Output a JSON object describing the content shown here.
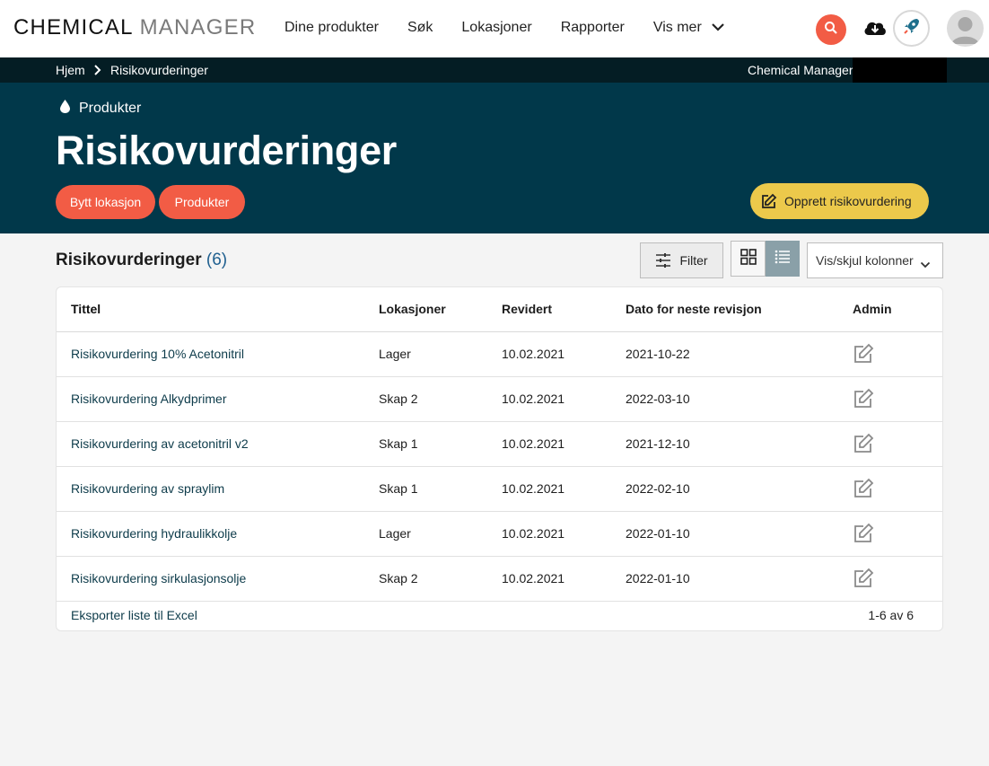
{
  "header": {
    "logo_part1": "CHEMICAL",
    "logo_part2": "MANAGER",
    "nav": [
      "Dine produkter",
      "Søk",
      "Lokasjoner",
      "Rapporter",
      "Vis mer"
    ],
    "icons": [
      "search-icon",
      "cloud-download-icon",
      "rocket-icon",
      "avatar-icon"
    ],
    "accent_color": "#f25c45"
  },
  "breadcrumb": {
    "home": "Hjem",
    "current": "Risikovurderinger",
    "right_label": "Chemical Manager"
  },
  "hero": {
    "section": "Produkter",
    "title": "Risikovurderinger",
    "buttons": [
      "Bytt lokasjon",
      "Produkter"
    ],
    "create_label": "Opprett risikovurdering",
    "background_color": "#01384a",
    "create_color": "#ecc94b"
  },
  "list": {
    "title": "Risikovurderinger",
    "count": "(6)",
    "filter_label": "Filter",
    "columns_label": "Vis/skjul kolonner",
    "active_view": "list",
    "headers": [
      "Tittel",
      "Lokasjoner",
      "Revidert",
      "Dato for neste revisjon",
      "Admin"
    ],
    "rows": [
      {
        "title": "Risikovurdering 10% Acetonitril",
        "location": "Lager",
        "revised": "10.02.2021",
        "next": "2021-10-22"
      },
      {
        "title": "Risikovurdering Alkydprimer",
        "location": "Skap 2",
        "revised": "10.02.2021",
        "next": "2022-03-10"
      },
      {
        "title": "Risikovurdering av acetonitril v2",
        "location": "Skap 1",
        "revised": "10.02.2021",
        "next": "2021-12-10"
      },
      {
        "title": "Risikovurdering av spraylim",
        "location": "Skap 1",
        "revised": "10.02.2021",
        "next": "2022-02-10"
      },
      {
        "title": "Risikovurdering hydraulikkolje",
        "location": "Lager",
        "revised": "10.02.2021",
        "next": "2022-01-10"
      },
      {
        "title": "Risikovurdering sirkulasjonsolje",
        "location": "Skap 2",
        "revised": "10.02.2021",
        "next": "2022-01-10"
      }
    ],
    "export_label": "Eksporter liste til Excel",
    "pagination": "1-6 av 6"
  }
}
